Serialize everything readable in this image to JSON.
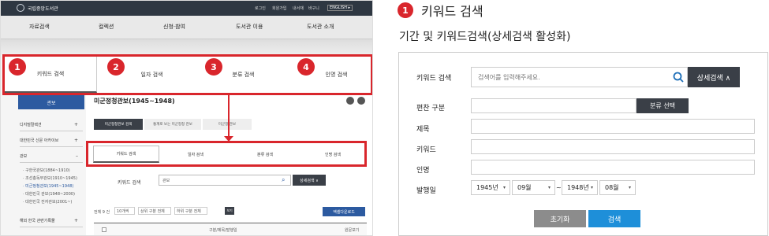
{
  "left": {
    "logo": "국립중앙도서관",
    "top_links": [
      "로그인",
      "회원가입",
      "내서재",
      "바구니",
      "ENGLISH ▸"
    ],
    "nav": [
      "자료검색",
      "컬렉션",
      "신청·참여",
      "도서관 이용",
      "도서관 소개"
    ],
    "tabs": [
      "키워드 검색",
      "일자 검색",
      "분류 검색",
      "인명 검색"
    ],
    "badges": [
      "1",
      "2",
      "3",
      "4"
    ],
    "page_title": "미군정청관보(1945~1948)",
    "sidebar_highlight": "관보",
    "sidebar": [
      {
        "label": "디지털컬렉션",
        "mark": "+"
      },
      {
        "label": "대한민국 신문 아카이브",
        "mark": "+"
      },
      {
        "label": "관보",
        "mark": "–"
      }
    ],
    "sidebar_subs": [
      "· 구한국관보(1884~1910)",
      "· 조선총독부관보(1910~1945)",
      "· 미군정청관보(1945~1948)",
      "· 대한민국 관보(1948~2000)",
      "· 대한민국 전자관보(2001~)"
    ],
    "sidebar_bottom": {
      "label": "해외 한국 관련기록물",
      "mark": "+"
    },
    "subtabs": [
      "미군정청관보 검색",
      "통계로 보는 미군정청 관보",
      "미군정 관보"
    ],
    "small_tabs": [
      "키워드 검색",
      "일자 검색",
      "분류 검색",
      "인명 검색"
    ],
    "search_label": "키워드 검색",
    "search_value": "관보",
    "adv_btn": "상세검색 ∨",
    "result_count": "전체 9 건",
    "result_selects": [
      "10개씩",
      "상위 구분 전체",
      "하위 구분 전체"
    ],
    "go_btn": "보기",
    "excel_btn": "엑셀다운로드",
    "table_header": [
      "구분/제목/발행일",
      "원문보기"
    ]
  },
  "right": {
    "step_badge": "1",
    "title": "키워드 검색",
    "subtitle": "기간 및 키워드검색(상세검색 활성화)",
    "form": {
      "keyword_label": "키워드 검색",
      "keyword_placeholder": "검색어를 입력해주세요.",
      "adv_button": "상세검색 ∧",
      "category_label": "편찬 구분",
      "category_button": "분류 선택",
      "title_label": "제목",
      "keyword2_label": "키워드",
      "person_label": "인명",
      "date_label": "발행일",
      "date_from_year": "1945년",
      "date_from_month": "09월",
      "date_sep": "~",
      "date_to_year": "1948년",
      "date_to_month": "08월",
      "reset_button": "초기화",
      "search_button": "검색"
    }
  },
  "colors": {
    "accent": "#d9262c",
    "dark": "#3a3f47",
    "blue": "#1e8fd9",
    "gray_btn": "#8c8c8c"
  }
}
